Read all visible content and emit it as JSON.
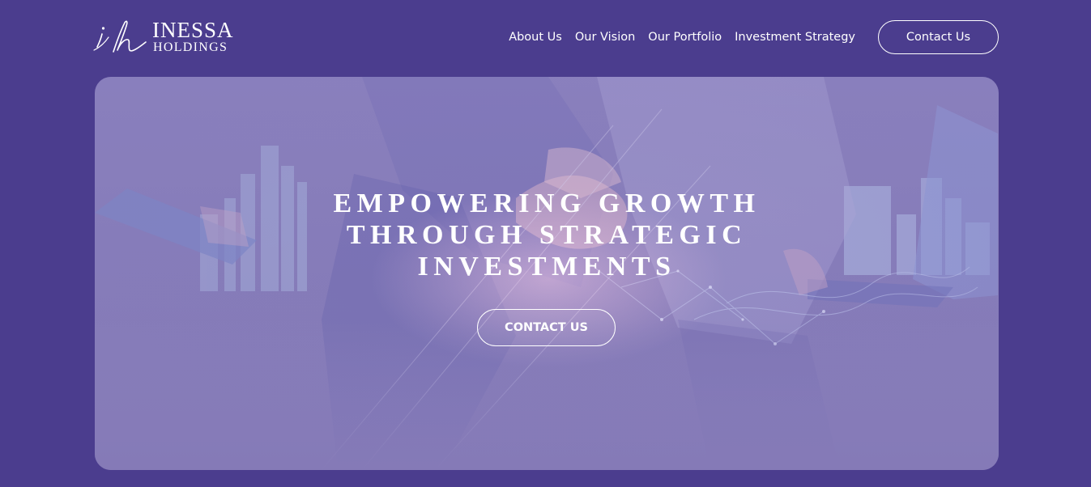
{
  "brand": {
    "monogram": "ih",
    "name": "INESSA",
    "subname": "HOLDINGS"
  },
  "nav": {
    "items": [
      {
        "label": "About Us"
      },
      {
        "label": "Our Vision"
      },
      {
        "label": "Our Portfolio"
      },
      {
        "label": "Investment Strategy"
      }
    ],
    "contact_label": "Contact Us"
  },
  "hero": {
    "title_lines": [
      "EMPOWERING GROWTH",
      "THROUGH STRATEGIC",
      "INVESTMENTS"
    ],
    "cta_label": "CONTACT US",
    "background_icon": "business-handshake-city-image"
  },
  "colors": {
    "page_bg": "#4b3d8e",
    "hero_bg": "#877dba",
    "text": "#ffffff"
  }
}
